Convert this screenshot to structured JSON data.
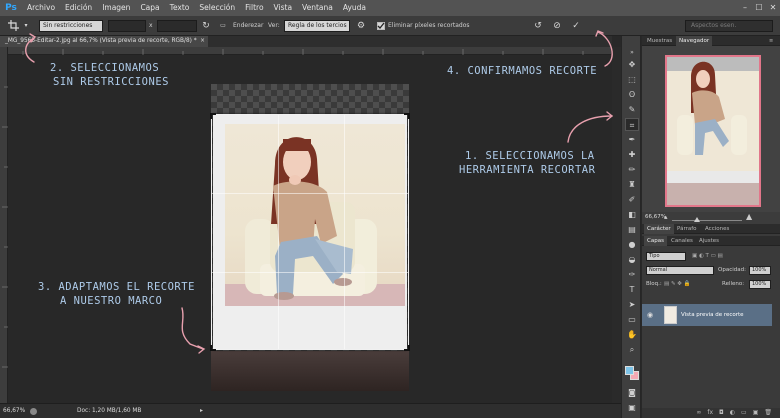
{
  "app": {
    "logo": "Ps",
    "menu": [
      "Archivo",
      "Edición",
      "Imagen",
      "Capa",
      "Texto",
      "Selección",
      "Filtro",
      "Vista",
      "Ventana",
      "Ayuda"
    ],
    "window_controls": [
      "–",
      "☐",
      "✕"
    ]
  },
  "options_bar": {
    "tool_icon": "crop-icon",
    "ratio_select": "Sin restricciones",
    "swap_symbol": "x",
    "straighten_label": "Enderezar",
    "view_label": "Ver:",
    "view_select": "Regla de los tercios",
    "delete_pixels_label": "Eliminar píxeles recortados",
    "delete_pixels_checked": true,
    "search_placeholder": "Aspectos esen."
  },
  "document": {
    "tab_title": "_MG_9563-Editar-2.jpg al 66,7% (Vista previa de recorte, RGB/8) *",
    "tab_close": "×"
  },
  "annotations": {
    "step1_line1": "1. SELECCIONAMOS LA",
    "step1_line2": "HERRAMIENTA RECORTAR",
    "step2_line1": "2. SELECCIONAMOS",
    "step2_line2": "SIN RESTRICCIONES",
    "step3_line1": "3. ADAPTAMOS EL RECORTE",
    "step3_line2": "A NUESTRO MARCO",
    "step4": "4. CONFIRMAMOS RECORTE",
    "color": "#aecbe9",
    "arrow_color": "#e8a0ae"
  },
  "navigator": {
    "tabs": [
      "Muestras",
      "Navegador"
    ],
    "active_tab": "Navegador",
    "zoom": "66,67%",
    "frame_color": "#e2768a"
  },
  "character_panel": {
    "tabs": [
      "Carácter",
      "Párrafo",
      "Acciones"
    ]
  },
  "layers": {
    "tabs": [
      "Capas",
      "Canales",
      "Ajustes"
    ],
    "kind_select": "Tipo",
    "blend_select": "Normal",
    "opacity_label": "Opacidad:",
    "opacity_value": "100%",
    "lock_label": "Bloq.:",
    "fill_label": "Relleno:",
    "fill_value": "100%",
    "items": [
      {
        "name": "Vista previa de recorte",
        "visible": true
      }
    ]
  },
  "status": {
    "zoom": "66,67%",
    "doc_size": "Doc: 1,20 MB/1,60 MB"
  },
  "colors": {
    "foreground": "#7ec4e8",
    "background": "#f4a9b4"
  }
}
